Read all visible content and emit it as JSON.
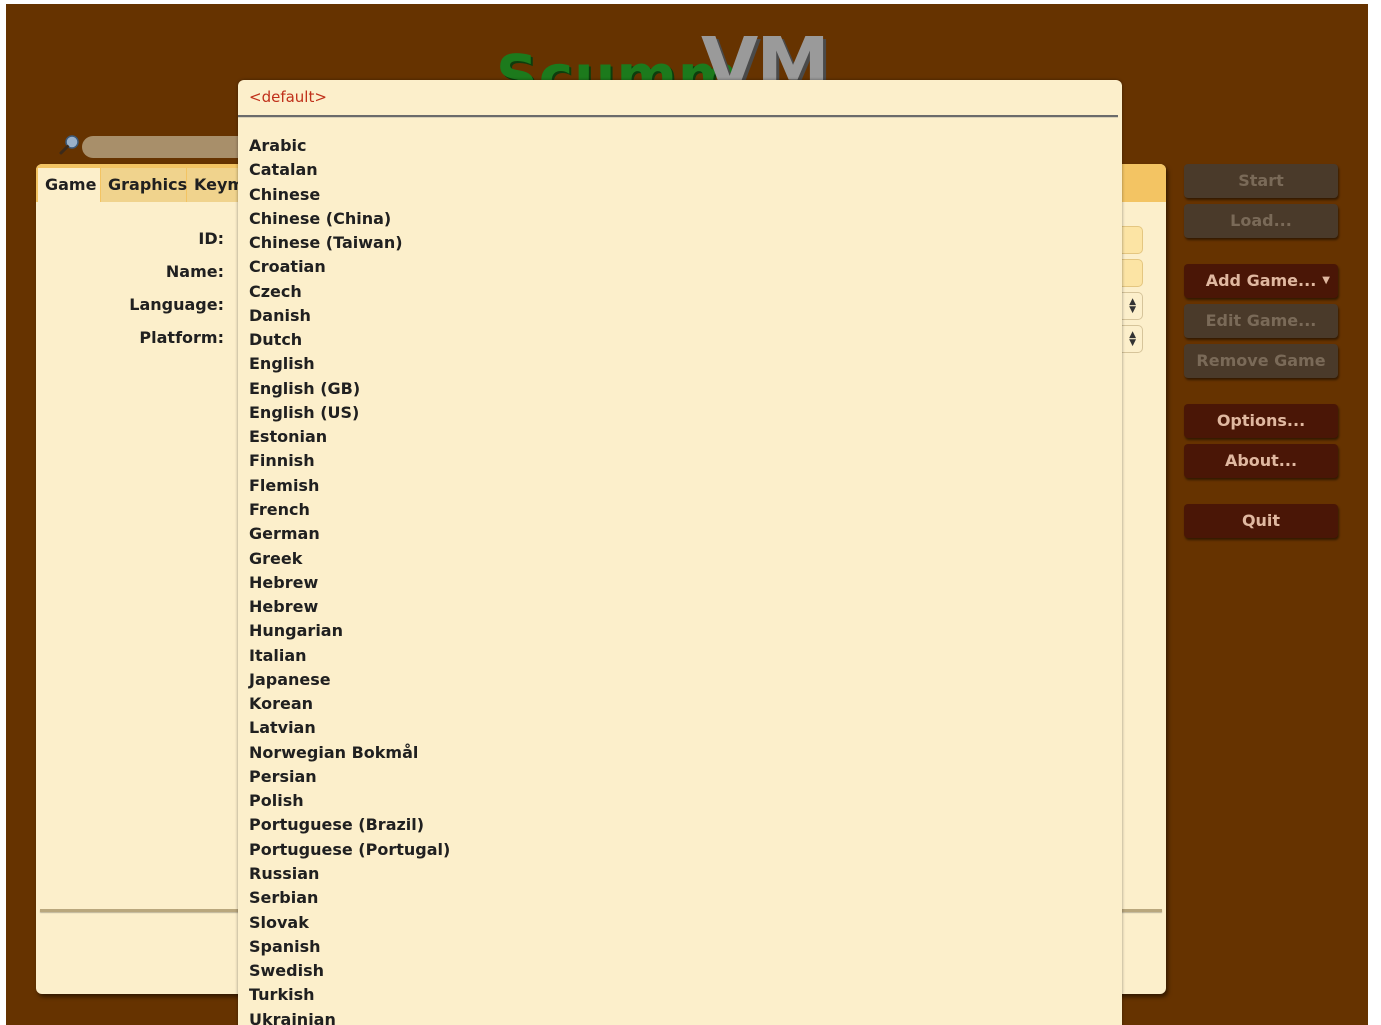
{
  "logo": {
    "part1": "Scumm",
    "part2": "VM"
  },
  "tabs": [
    {
      "label": "Game"
    },
    {
      "label": "Graphics"
    },
    {
      "label": "Keym"
    }
  ],
  "form": {
    "id_label": "ID:",
    "name_label": "Name:",
    "language_label": "Language:",
    "platform_label": "Platform:"
  },
  "buttons": {
    "start": "Start",
    "load": "Load...",
    "add_game": "Add Game...",
    "edit_game": "Edit Game...",
    "remove_game": "Remove Game",
    "options": "Options...",
    "about": "About...",
    "quit": "Quit"
  },
  "language_popup": {
    "default_option": "<default>",
    "options": [
      "Arabic",
      "Catalan",
      "Chinese",
      "Chinese (China)",
      "Chinese (Taiwan)",
      "Croatian",
      "Czech",
      "Danish",
      "Dutch",
      "English",
      "English (GB)",
      "English (US)",
      "Estonian",
      "Finnish",
      "Flemish",
      "French",
      "German",
      "Greek",
      "Hebrew",
      "Hebrew",
      "Hungarian",
      "Italian",
      "Japanese",
      "Korean",
      "Latvian",
      "Norwegian Bokmål",
      "Persian",
      "Polish",
      "Portuguese (Brazil)",
      "Portuguese (Portugal)",
      "Russian",
      "Serbian",
      "Slovak",
      "Spanish",
      "Swedish",
      "Turkish",
      "Ukrainian"
    ]
  },
  "colors": {
    "background": "#663300",
    "panel": "#fcefcb",
    "tab_bar": "#f3c463",
    "button_enabled": "#4a1606",
    "button_disabled": "#4a3a2a",
    "default_option": "#c0301a"
  }
}
